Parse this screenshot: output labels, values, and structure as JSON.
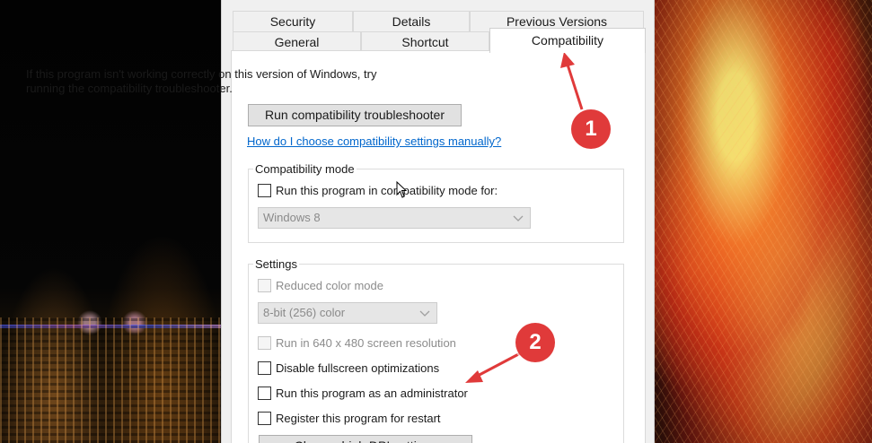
{
  "tabs": {
    "row1": [
      "Security",
      "Details",
      "Previous Versions"
    ],
    "row2": [
      "General",
      "Shortcut",
      "Compatibility"
    ],
    "active": "Compatibility"
  },
  "intro_text": "If this program isn't working correctly on this version of Windows, try running the compatibility troubleshooter.",
  "troubleshooter_button": "Run compatibility troubleshooter",
  "help_link": "How do I choose compatibility settings manually?",
  "compat_mode": {
    "title": "Compatibility mode",
    "checkbox_label": "Run this program in compatibility mode for:",
    "select_value": "Windows 8"
  },
  "settings": {
    "title": "Settings",
    "reduced_color": "Reduced color mode",
    "color_select_value": "8-bit (256) color",
    "resolution_640": "Run in 640 x 480 screen resolution",
    "disable_fullscreen": "Disable fullscreen optimizations",
    "run_as_admin": "Run this program as an administrator",
    "register_restart": "Register this program for restart",
    "cut_button": "Change high DPI settings"
  },
  "annotations": {
    "marker1": "1",
    "marker2": "2",
    "color": "#e03a3a"
  }
}
